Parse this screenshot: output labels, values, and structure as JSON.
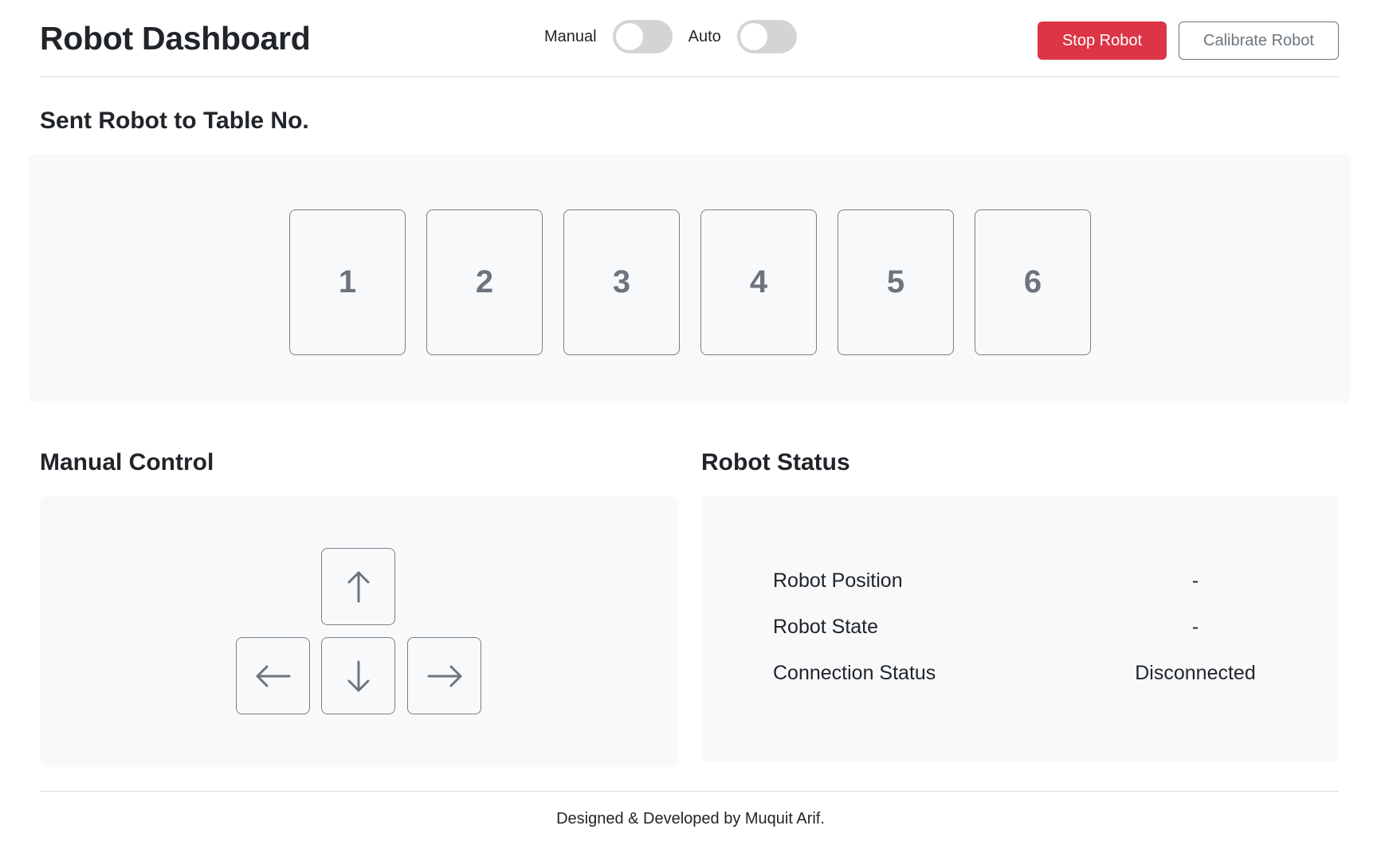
{
  "header": {
    "title": "Robot Dashboard",
    "modes": [
      {
        "label": "Manual",
        "on": false
      },
      {
        "label": "Auto",
        "on": false
      }
    ],
    "stop_label": "Stop Robot",
    "calibrate_label": "Calibrate Robot"
  },
  "tables_section": {
    "title": "Sent Robot to Table No.",
    "tables": [
      "1",
      "2",
      "3",
      "4",
      "5",
      "6"
    ]
  },
  "manual_control": {
    "title": "Manual Control",
    "icons": [
      "arrow-up-icon",
      "arrow-left-icon",
      "arrow-down-icon",
      "arrow-right-icon"
    ]
  },
  "status": {
    "title": "Robot Status",
    "rows": [
      {
        "label": "Robot Position",
        "value": "-"
      },
      {
        "label": "Robot State",
        "value": "-"
      },
      {
        "label": "Connection Status",
        "value": "Disconnected"
      }
    ]
  },
  "footer": {
    "text": "Designed & Developed by Muquit Arif."
  },
  "colors": {
    "danger": "#dc3545",
    "secondary": "#6c757d",
    "panel_bg": "#f8f9fa",
    "switch_off": "#d4d4d4"
  }
}
